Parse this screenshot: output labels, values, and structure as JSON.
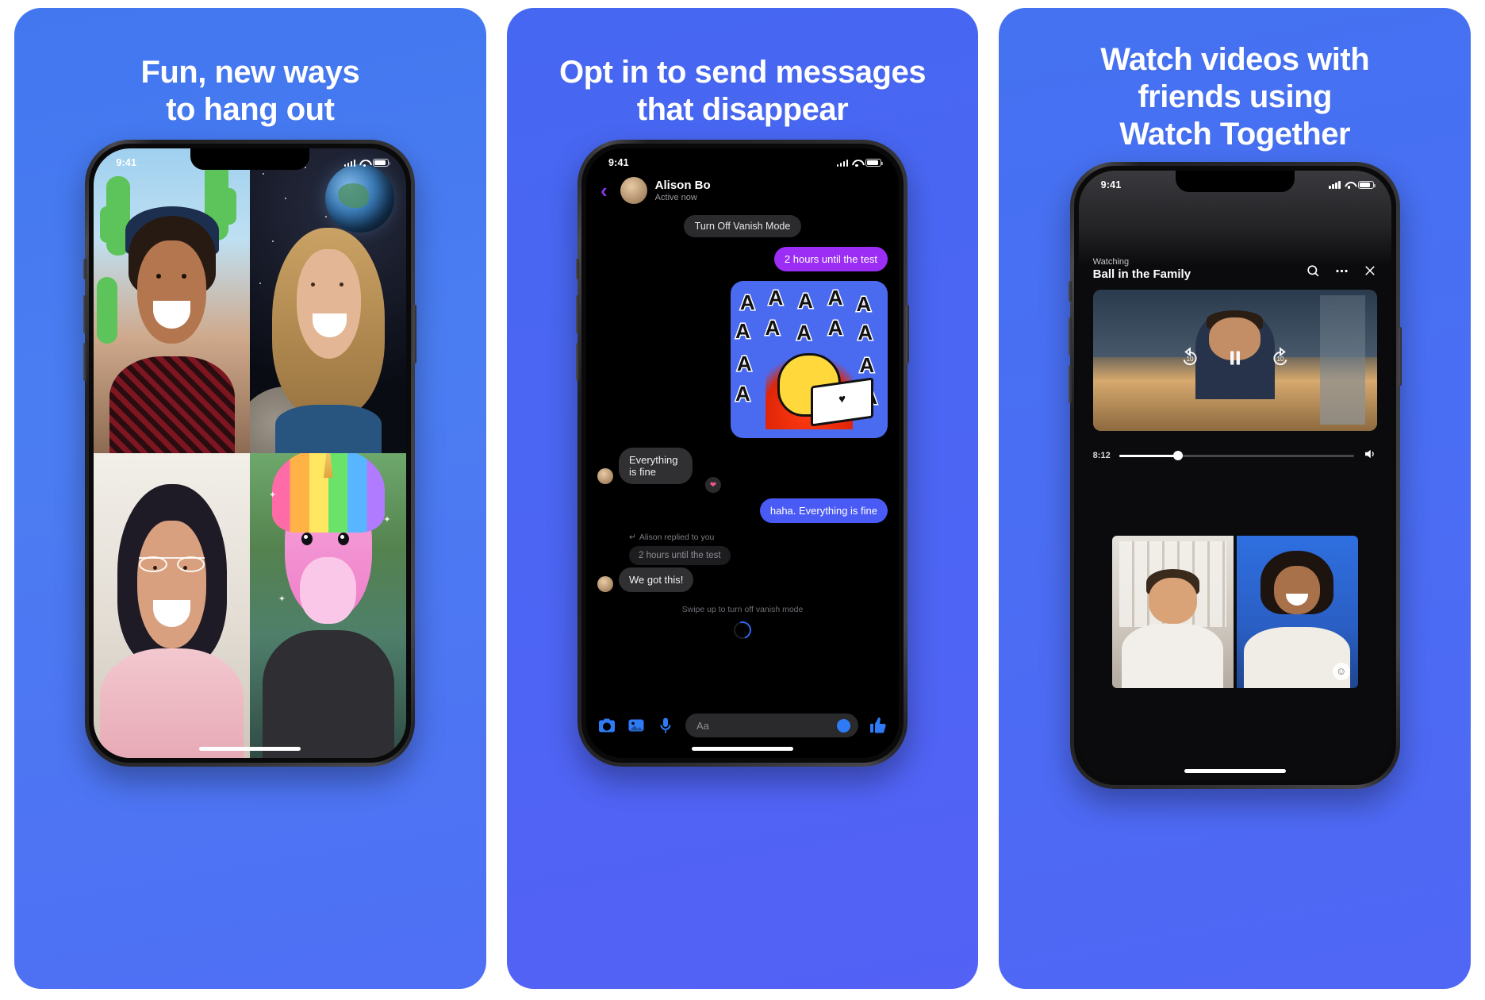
{
  "panels": [
    {
      "headline": "Fun, new ways\nto hang out",
      "status": {
        "time": "9:41"
      },
      "tiles": [
        {
          "name": "cactus-filter-participant"
        },
        {
          "name": "space-earth-filter-participant"
        },
        {
          "name": "glasses-filter-participant"
        },
        {
          "name": "unicorn-filter-participant"
        }
      ]
    },
    {
      "headline": "Opt in to send messages\nthat disappear",
      "status": {
        "time": "9:41"
      },
      "chat": {
        "contact_name": "Alison Bo",
        "contact_status": "Active now",
        "back_icon": "chevron-left-icon",
        "system_pill": "Turn Off Vanish Mode",
        "messages": [
          {
            "type": "sent",
            "text": "2 hours until the test",
            "color": "#9b2df5"
          },
          {
            "type": "sticker",
            "text": "AAAAAA",
            "color": "#4a6bf0"
          },
          {
            "type": "received",
            "text": "Everything is fine",
            "reaction": "❤"
          },
          {
            "type": "sent",
            "text": "haha. Everything is fine",
            "color": "#4a5bf5"
          }
        ],
        "reply_label": "Alison replied to you",
        "quoted_text": "2 hours until the test",
        "reply_text": "We got this!",
        "swipe_hint": "Swipe up to turn off vanish mode",
        "composer": {
          "placeholder": "Aa",
          "icons": [
            "camera-icon",
            "gallery-icon",
            "microphone-icon"
          ],
          "emoji_icon": "emoji-icon",
          "send_icon": "thumbs-up-icon"
        }
      }
    },
    {
      "headline": "Watch videos with\nfriends using\nWatch Together",
      "status": {
        "time": "9:41"
      },
      "watch": {
        "watching_label": "Watching",
        "video_title": "Ball in the Family",
        "actions": [
          "search-icon",
          "more-icon",
          "close-icon"
        ],
        "player_controls": [
          "rewind-10-icon",
          "pause-icon",
          "forward-10-icon"
        ],
        "current_time": "8:12",
        "progress_percent": 25,
        "volume_icon": "volume-icon",
        "participants": [
          {
            "name": "participant-left"
          },
          {
            "name": "participant-right",
            "emoji_icon": "emoji-reaction-icon"
          }
        ]
      }
    }
  ],
  "colors": {
    "panel_blue_1": "#4277f0",
    "panel_blue_2": "#4667f2",
    "panel_blue_3": "#4472f1",
    "accent_purple": "#9b2df5",
    "accent_blue": "#4a5bf5",
    "messenger_blue": "#2f7bf6"
  }
}
